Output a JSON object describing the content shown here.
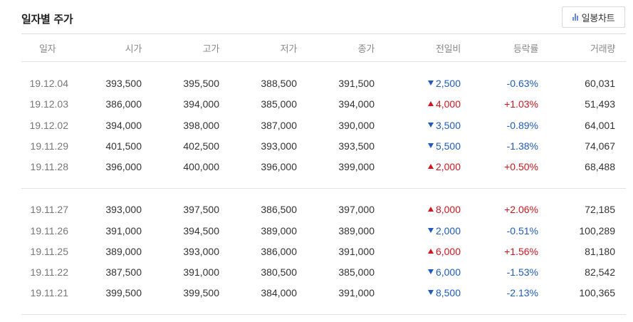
{
  "header": {
    "title": "일자별 주가",
    "chart_button_label": "일봉차트"
  },
  "columns": [
    "일자",
    "시가",
    "고가",
    "저가",
    "종가",
    "전일비",
    "등락률",
    "거래량"
  ],
  "rows": [
    {
      "date": "19.12.04",
      "open": "393,500",
      "high": "395,500",
      "low": "388,500",
      "close": "391,500",
      "dir": "down",
      "change": "2,500",
      "rate": "-0.63%",
      "volume": "60,031"
    },
    {
      "date": "19.12.03",
      "open": "386,000",
      "high": "394,000",
      "low": "385,000",
      "close": "394,000",
      "dir": "up",
      "change": "4,000",
      "rate": "+1.03%",
      "volume": "51,493"
    },
    {
      "date": "19.12.02",
      "open": "394,000",
      "high": "398,000",
      "low": "387,000",
      "close": "390,000",
      "dir": "down",
      "change": "3,500",
      "rate": "-0.89%",
      "volume": "64,001"
    },
    {
      "date": "19.11.29",
      "open": "401,500",
      "high": "402,500",
      "low": "393,000",
      "close": "393,500",
      "dir": "down",
      "change": "5,500",
      "rate": "-1.38%",
      "volume": "74,067"
    },
    {
      "date": "19.11.28",
      "open": "396,000",
      "high": "400,000",
      "low": "396,000",
      "close": "399,000",
      "dir": "up",
      "change": "2,000",
      "rate": "+0.50%",
      "volume": "68,488"
    },
    {
      "date": "19.11.27",
      "open": "393,000",
      "high": "397,500",
      "low": "386,500",
      "close": "397,000",
      "dir": "up",
      "change": "8,000",
      "rate": "+2.06%",
      "volume": "72,185"
    },
    {
      "date": "19.11.26",
      "open": "391,000",
      "high": "394,500",
      "low": "389,000",
      "close": "389,000",
      "dir": "down",
      "change": "2,000",
      "rate": "-0.51%",
      "volume": "100,289"
    },
    {
      "date": "19.11.25",
      "open": "389,000",
      "high": "393,000",
      "low": "386,000",
      "close": "391,000",
      "dir": "up",
      "change": "6,000",
      "rate": "+1.56%",
      "volume": "81,180"
    },
    {
      "date": "19.11.22",
      "open": "387,500",
      "high": "391,000",
      "low": "380,500",
      "close": "385,000",
      "dir": "down",
      "change": "6,000",
      "rate": "-1.53%",
      "volume": "82,542"
    },
    {
      "date": "19.11.21",
      "open": "399,500",
      "high": "399,500",
      "low": "384,000",
      "close": "391,000",
      "dir": "down",
      "change": "8,500",
      "rate": "-2.13%",
      "volume": "100,365"
    }
  ],
  "colors": {
    "up": "#d2161e",
    "down": "#1f5bbd"
  }
}
